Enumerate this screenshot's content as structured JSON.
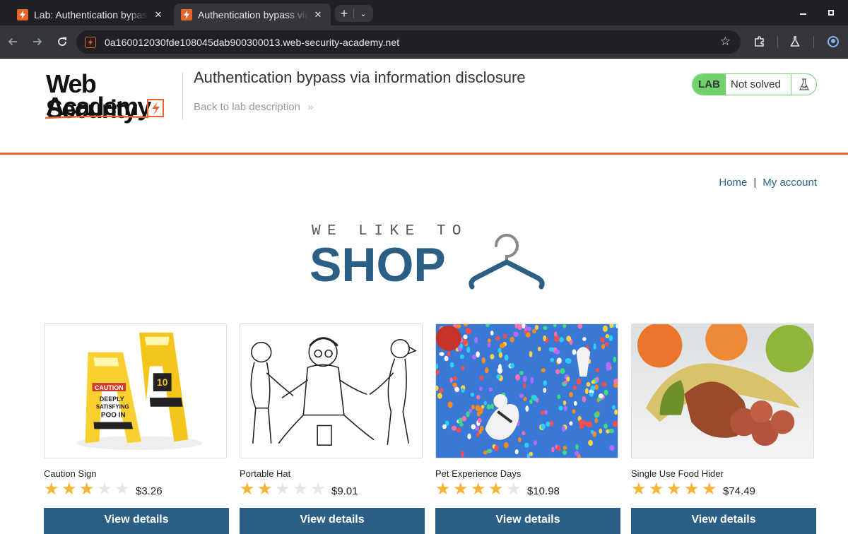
{
  "browser": {
    "tabs": [
      {
        "title": "Lab: Authentication bypass via information disclosure",
        "active": false
      },
      {
        "title": "Authentication bypass via information disclosure",
        "active": true
      }
    ],
    "url": "0a160012030fde108045dab900300013.web-security-academy.net"
  },
  "header": {
    "logo_line1": "Web Security",
    "logo_line2": "Academy",
    "lab_title": "Authentication bypass via information disclosure",
    "back_link": "Back to lab description",
    "back_chevron": "»",
    "lab_badge": "LAB",
    "lab_status": "Not solved"
  },
  "nav": {
    "home": "Home",
    "separator": "|",
    "account": "My account"
  },
  "banner": {
    "tagline": "WE LIKE TO",
    "headline": "SHOP"
  },
  "products": [
    {
      "name": "Caution Sign",
      "rating": 3,
      "price": "$3.26",
      "button": "View details"
    },
    {
      "name": "Portable Hat",
      "rating": 2,
      "price": "$9.01",
      "button": "View details"
    },
    {
      "name": "Pet Experience Days",
      "rating": 4,
      "price": "$10.98",
      "button": "View details"
    },
    {
      "name": "Single Use Food Hider",
      "rating": 5,
      "price": "$74.49",
      "button": "View details"
    }
  ],
  "colors": {
    "accent_orange": "#e8642c",
    "primary_blue": "#2b5f85",
    "link_blue": "#29668f",
    "lab_green": "#70d16d",
    "star_on": "#f5b234",
    "star_off": "#e6e6e6"
  }
}
